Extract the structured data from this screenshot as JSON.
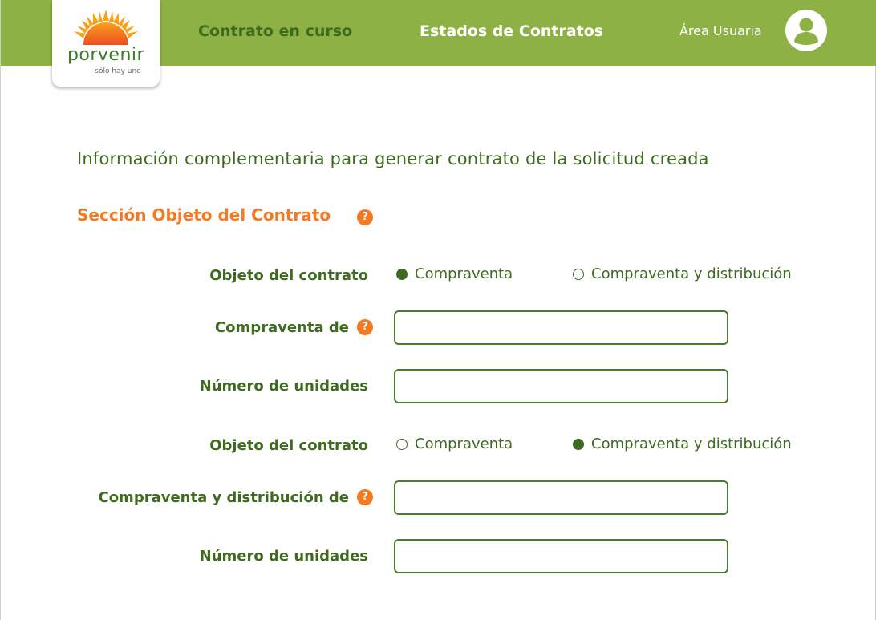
{
  "brand": {
    "name": "porvenir",
    "tagline": "sólo hay uno"
  },
  "nav": {
    "current_contract": "Contrato en curso",
    "contract_states": "Estados de Contratos",
    "user_area": "Área Usuaria"
  },
  "intro": "Información complementaria para generar contrato de la solicitud creada",
  "section": {
    "title": "Sección Objeto del Contrato",
    "help": "?"
  },
  "block1": {
    "object_label": "Objeto del contrato",
    "options": [
      {
        "label": "Compraventa",
        "selected": true
      },
      {
        "label": "Compraventa y distribución",
        "selected": false
      }
    ],
    "sale_of_label": "Compraventa de",
    "sale_of_help": "?",
    "sale_of_value": "",
    "units_label": "Número de unidades",
    "units_value": ""
  },
  "block2": {
    "object_label": "Objeto del contrato",
    "options": [
      {
        "label": "Compraventa",
        "selected": false
      },
      {
        "label": "Compraventa y distribución",
        "selected": true
      }
    ],
    "sale_dist_label": "Compraventa y distribución de",
    "sale_dist_help": "?",
    "sale_dist_value": "",
    "units_label": "Número de unidades",
    "units_value": ""
  },
  "colors": {
    "header_green": "#8db145",
    "dark_green": "#3e6b1f",
    "accent_orange": "#f47920"
  },
  "icons": {
    "logo": "sun-logo-icon",
    "user": "user-avatar-icon",
    "help": "question-icon"
  }
}
